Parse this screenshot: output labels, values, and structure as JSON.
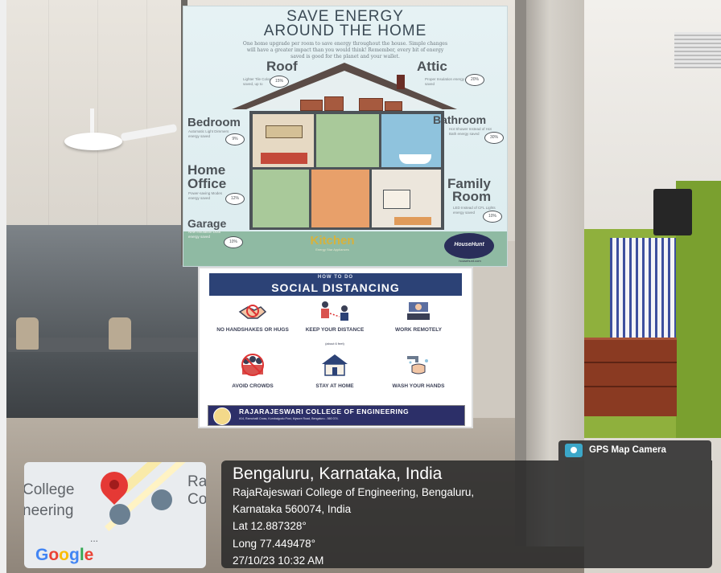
{
  "poster_energy": {
    "title_line1": "SAVE ENERGY",
    "title_line2": "AROUND THE HOME",
    "intro": "One home upgrade per room to save energy throughout the house. Simple changes will have a greater impact than you would think! Remember, every bit of energy saved is good for the planet and your wallet.",
    "rooms": {
      "roof": {
        "label": "Roof",
        "sub": "Lighter Tile Color energy saved, up to",
        "pct": "15%"
      },
      "attic": {
        "label": "Attic",
        "sub": "Proper Insulation energy saved",
        "pct": "20%"
      },
      "bedroom": {
        "label": "Bedroom",
        "sub": "Automatic Light Dimmers energy saved",
        "pct": "9%"
      },
      "bathroom": {
        "label": "Bathroom",
        "sub": "Hot Shower Instead of Hot Bath energy saved",
        "pct": "30%"
      },
      "home_office": {
        "label_line1": "Home",
        "label_line2": "Office",
        "sub": "Power-saving Modes energy saved",
        "pct": "12%"
      },
      "family_room": {
        "label_line1": "Family",
        "label_line2": "Room",
        "sub": "LED Instead of CFL Lights energy saved",
        "pct": "10%"
      },
      "garage": {
        "label": "Garage",
        "sub": "New Insulation Door energy saved",
        "pct": "10%"
      }
    },
    "kitchen_label": "Kitchen",
    "kitchen_sub": "Energy Star Appliances",
    "logo": "HouseHunt",
    "logo_sub": "househunt.com"
  },
  "poster_distancing": {
    "how_to_do": "HOW TO DO",
    "title": "SOCIAL DISTANCING",
    "cells": [
      {
        "label": "NO HANDSHAKES OR HUGS",
        "sub": "",
        "icon": "handshake-icon"
      },
      {
        "label": "KEEP YOUR DISTANCE",
        "sub": "(about 6 feet)",
        "icon": "distance-icon"
      },
      {
        "label": "WORK REMOTELY",
        "sub": "",
        "icon": "laptop-icon"
      },
      {
        "label": "AVOID CROWDS",
        "sub": "",
        "icon": "crowd-icon"
      },
      {
        "label": "STAY AT HOME",
        "sub": "",
        "icon": "home-icon"
      },
      {
        "label": "WASH YOUR HANDS",
        "sub": "",
        "icon": "wash-hands-icon"
      }
    ],
    "college": "RAJARAJESWARI COLLEGE OF ENGINEERING",
    "address": "#14, Ramohalli Cross, Kumbalgodu Post, Mysore Road, Bengaluru - 560 074."
  },
  "gps": {
    "badge": "GPS Map Camera",
    "location": "Bengaluru, Karnataka, India",
    "address_line1": "RajaRajeswari College of Engineering, Bengaluru,",
    "address_line2": "Karnataka 560074, India",
    "lat": "Lat 12.887328°",
    "long": "Long 77.449478°",
    "datetime": "27/10/23 10:32 AM"
  },
  "map": {
    "text_college": "College",
    "text_neering": "neering",
    "text_ra": "Ra",
    "text_co": "Co",
    "ellipsis": "...",
    "google_letters": [
      "G",
      "o",
      "o",
      "g",
      "l",
      "e"
    ],
    "google_colors": [
      "#4285F4",
      "#EA4335",
      "#FBBC05",
      "#4285F4",
      "#34A853",
      "#EA4335"
    ],
    "pin_color": "#E53935"
  }
}
